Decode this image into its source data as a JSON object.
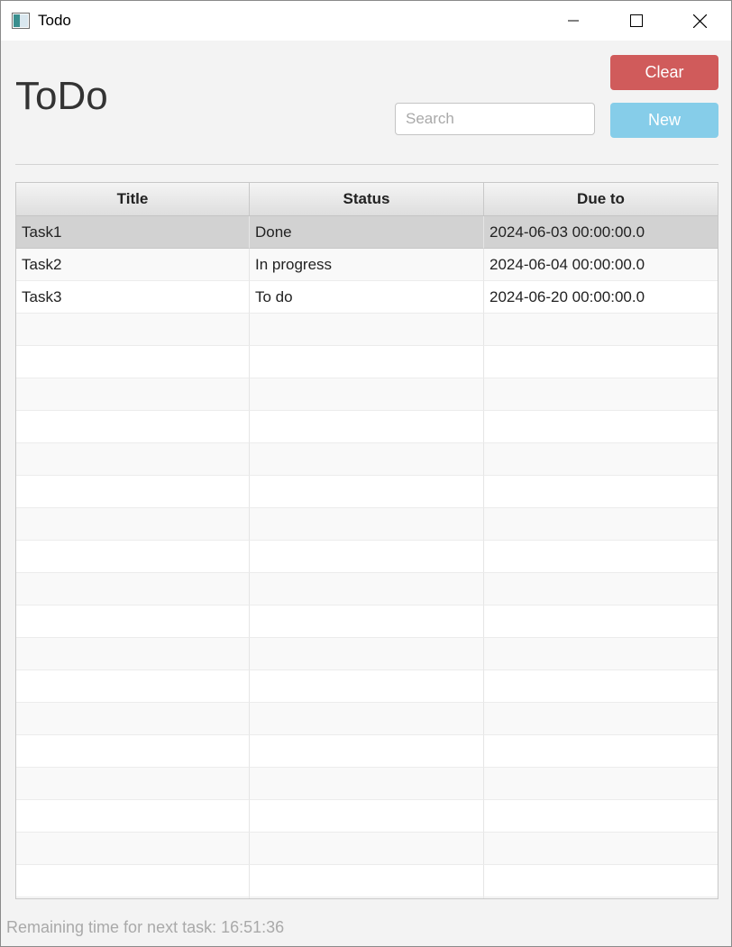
{
  "window": {
    "title": "Todo"
  },
  "header": {
    "title": "ToDo",
    "clear_label": "Clear",
    "new_label": "New",
    "search_placeholder": "Search",
    "colors": {
      "clear": "#d05b5b",
      "new": "#86cde9"
    }
  },
  "table": {
    "columns": [
      "Title",
      "Status",
      "Due to"
    ],
    "rows": [
      {
        "title": "Task1",
        "status": "Done",
        "due": "2024-06-03 00:00:00.0",
        "selected": true
      },
      {
        "title": "Task2",
        "status": "In progress",
        "due": "2024-06-04 00:00:00.0"
      },
      {
        "title": "Task3",
        "status": "To do",
        "due": "2024-06-20 00:00:00.0"
      }
    ]
  },
  "footer": {
    "remaining_label": "Remaining time for next task:",
    "remaining_time": "16:51:36"
  }
}
